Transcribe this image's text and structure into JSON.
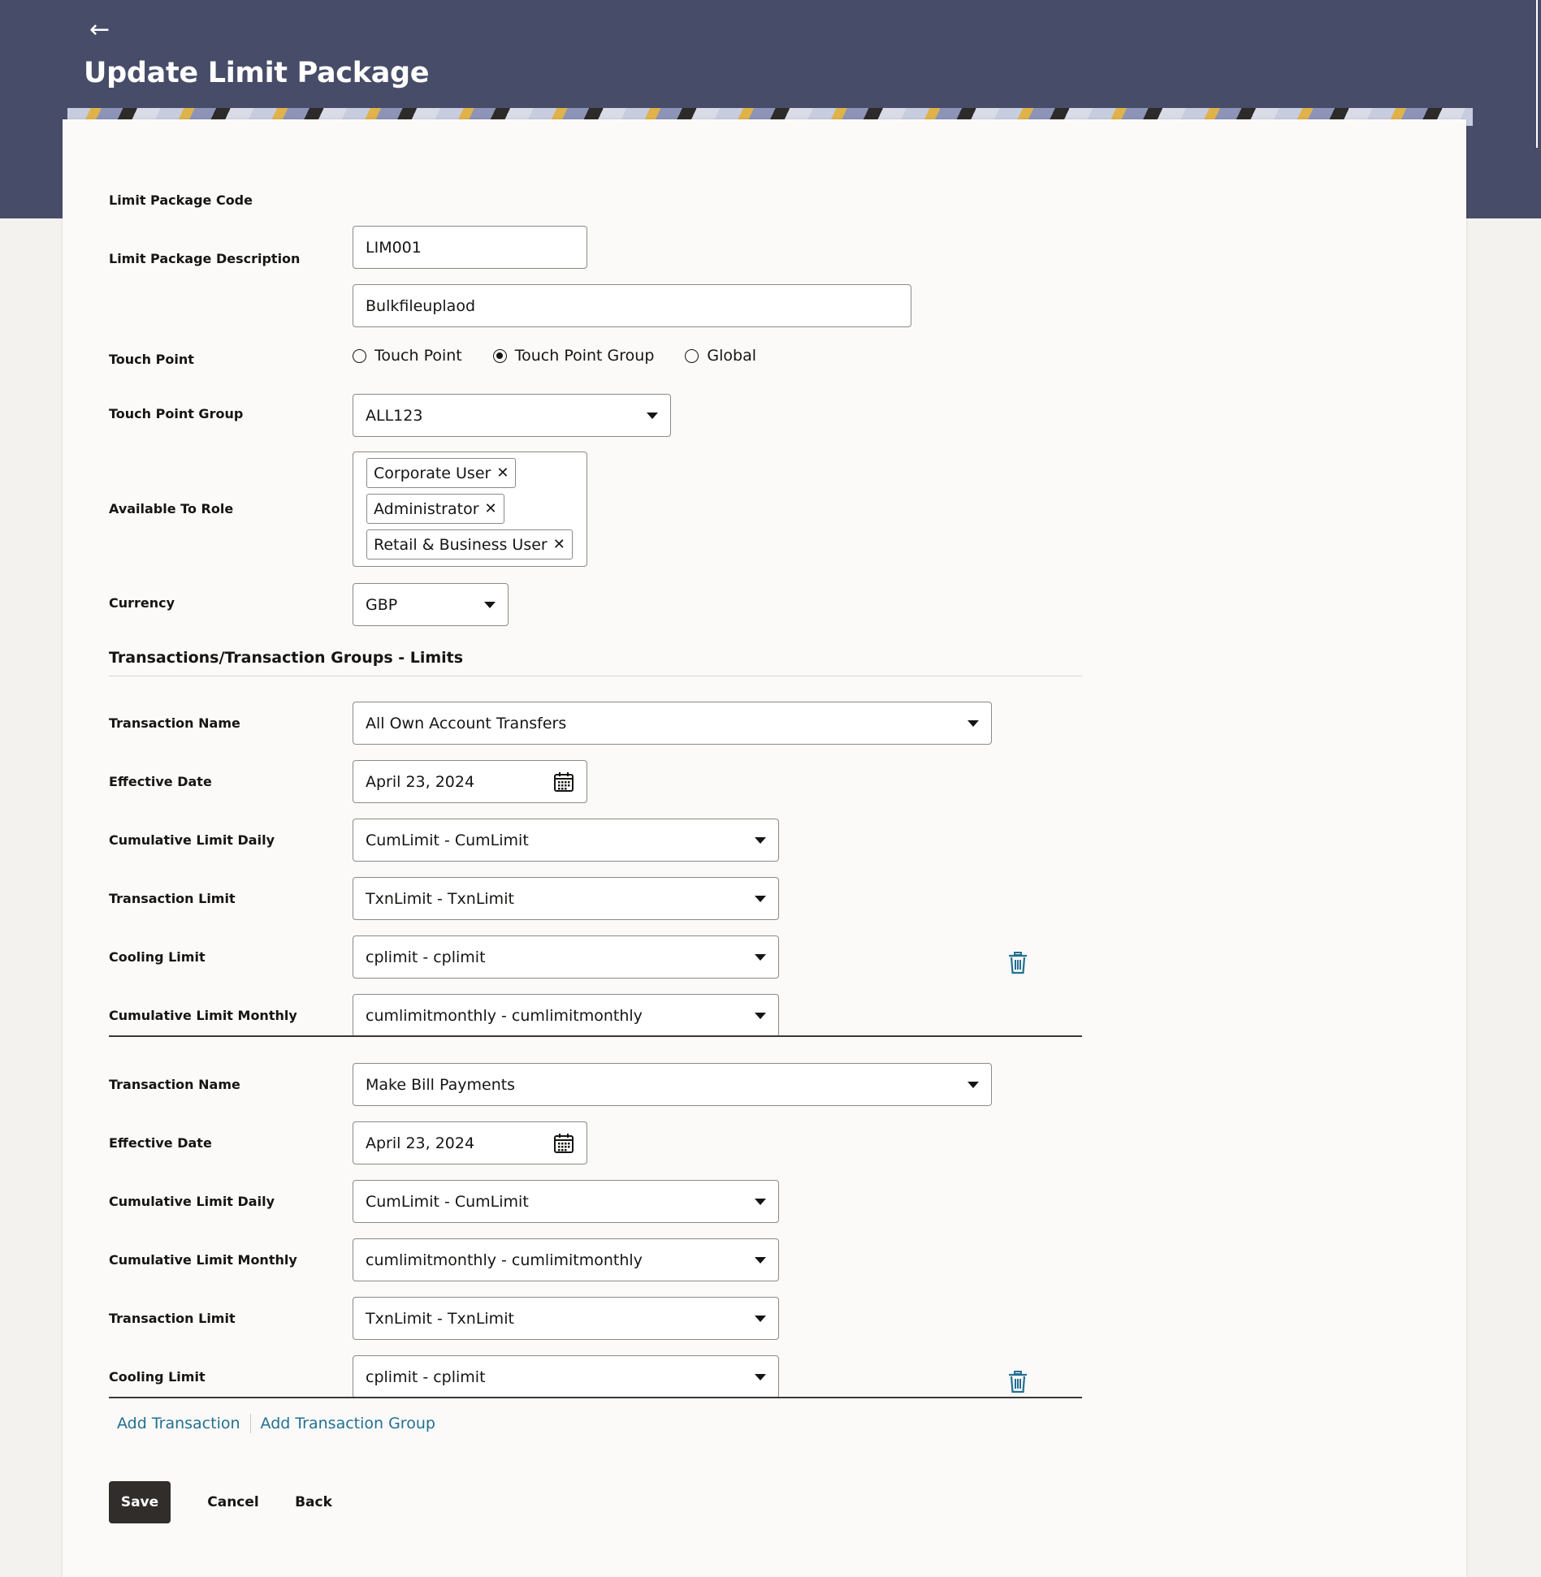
{
  "header": {
    "back_label": "←",
    "title": "Update Limit Package"
  },
  "form": {
    "code_label": "Limit Package Code",
    "code_value": "LIM001",
    "desc_label": "Limit Package Description",
    "desc_value": "Bulkfileuplaod",
    "touch_point_label": "Touch Point",
    "touch_point_options": [
      "Touch Point",
      "Touch Point Group",
      "Global"
    ],
    "touch_point_selected": "Touch Point Group",
    "tpg_label": "Touch Point Group",
    "tpg_value": "ALL123",
    "role_label": "Available To Role",
    "roles": [
      "Corporate User",
      "Administrator",
      "Retail & Business User"
    ],
    "currency_label": "Currency",
    "currency_value": "GBP"
  },
  "section_title": "Transactions/Transaction Groups - Limits",
  "transactions": [
    {
      "rows": [
        {
          "label": "Transaction Name",
          "value": "All Own Account Transfers"
        },
        {
          "label": "Effective Date",
          "value": "April 23, 2024"
        },
        {
          "label": "Cumulative Limit Daily",
          "value": "CumLimit - CumLimit"
        },
        {
          "label": "Transaction Limit",
          "value": "TxnLimit - TxnLimit"
        },
        {
          "label": "Cooling Limit",
          "value": "cplimit - cplimit"
        },
        {
          "label": "Cumulative Limit Monthly",
          "value": "cumlimitmonthly - cumlimitmonthly"
        }
      ]
    },
    {
      "rows": [
        {
          "label": "Transaction Name",
          "value": "Make Bill Payments"
        },
        {
          "label": "Effective Date",
          "value": "April 23, 2024"
        },
        {
          "label": "Cumulative Limit Daily",
          "value": "CumLimit - CumLimit"
        },
        {
          "label": "Cumulative Limit Monthly",
          "value": "cumlimitmonthly - cumlimitmonthly"
        },
        {
          "label": "Transaction Limit",
          "value": "TxnLimit - TxnLimit"
        },
        {
          "label": "Cooling Limit",
          "value": "cplimit - cplimit"
        }
      ]
    }
  ],
  "links": {
    "add_transaction": "Add Transaction",
    "add_group": "Add Transaction Group"
  },
  "buttons": {
    "save": "Save",
    "cancel": "Cancel",
    "back": "Back"
  },
  "icons": {
    "back": "back-arrow-icon",
    "dropdown": "caret-down-icon",
    "calendar": "calendar-icon",
    "remove": "close-icon",
    "delete": "trash-icon"
  },
  "colors": {
    "header_bg": "#474c69",
    "primary_button": "#312d2a",
    "link": "#227093"
  }
}
